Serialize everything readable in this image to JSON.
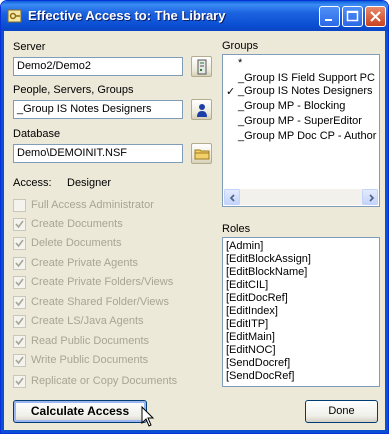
{
  "window": {
    "title": "Effective Access to:  The Library"
  },
  "server": {
    "label": "Server",
    "value": "Demo2/Demo2"
  },
  "people": {
    "label": "People, Servers, Groups",
    "value": "_Group IS Notes Designers"
  },
  "database": {
    "label": "Database",
    "value": "Demo\\DEMOINIT.NSF"
  },
  "access": {
    "label": "Access:",
    "value": "Designer"
  },
  "privileges": [
    {
      "label": "Full Access Administrator",
      "checked": false
    },
    {
      "label": "Create Documents",
      "checked": true
    },
    {
      "label": "Delete Documents",
      "checked": true
    },
    {
      "label": "Create Private Agents",
      "checked": true
    },
    {
      "label": "Create Private Folders/Views",
      "checked": true
    },
    {
      "label": "Create Shared Folder/Views",
      "checked": true
    },
    {
      "label": "Create LS/Java Agents",
      "checked": true
    },
    {
      "label": "Read Public Documents",
      "checked": true
    },
    {
      "label": "Write Public Documents",
      "checked": true
    },
    {
      "label": "Replicate or Copy Documents",
      "checked": true
    }
  ],
  "groups": {
    "label": "Groups",
    "items": [
      {
        "text": "*",
        "mark": ""
      },
      {
        "text": "_Group IS Field Support PC",
        "mark": ""
      },
      {
        "text": "_Group IS Notes Designers",
        "mark": "✓"
      },
      {
        "text": "_Group MP - Blocking",
        "mark": ""
      },
      {
        "text": "_Group MP - SuperEditor",
        "mark": ""
      },
      {
        "text": "_Group MP Doc CP - Author",
        "mark": ""
      }
    ]
  },
  "roles": {
    "label": "Roles",
    "items": [
      "[Admin]",
      "[EditBlockAssign]",
      "[EditBlockName]",
      "[EditCIL]",
      "[EditDocRef]",
      "[EditIndex]",
      "[EditITP]",
      "[EditMain]",
      "[EditNOC]",
      "[SendDocref]",
      "[SendDocRef]"
    ]
  },
  "buttons": {
    "calculate": "Calculate Access",
    "done": "Done"
  },
  "colors": {
    "titlebar": "#0b4fd2",
    "dialog": "#ece9d8",
    "disabled_text": "#a7a596"
  }
}
